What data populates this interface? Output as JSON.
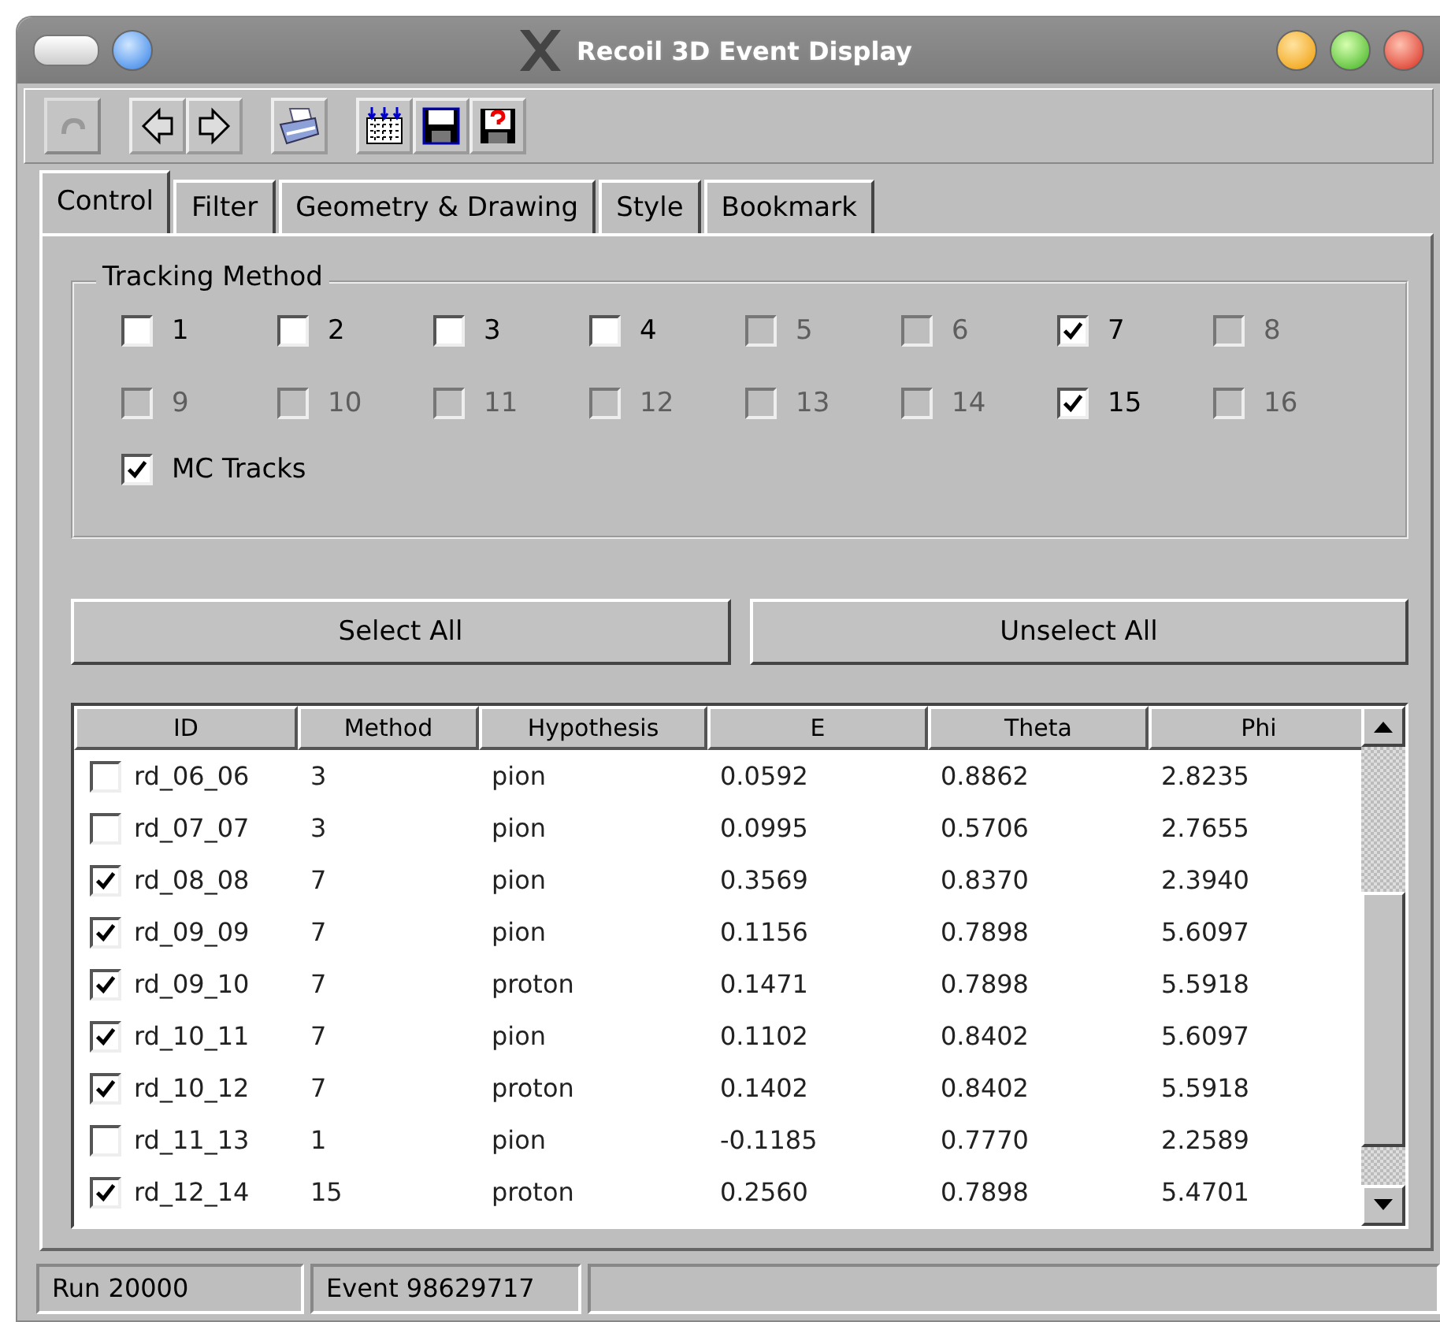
{
  "window": {
    "title": "Recoil 3D Event Display"
  },
  "toolbar": [
    {
      "kind": "back",
      "disabled": true
    },
    {
      "kind": "left",
      "disabled": false
    },
    {
      "kind": "right",
      "disabled": false
    },
    {
      "kind": "print",
      "disabled": false
    },
    {
      "kind": "load",
      "disabled": false
    },
    {
      "kind": "save",
      "disabled": false
    },
    {
      "kind": "help",
      "disabled": false
    }
  ],
  "tabs": [
    {
      "label": "Control",
      "selected": true
    },
    {
      "label": "Filter",
      "selected": false
    },
    {
      "label": "Geometry & Drawing",
      "selected": false
    },
    {
      "label": "Style",
      "selected": false
    },
    {
      "label": "Bookmark",
      "selected": false
    }
  ],
  "tracking_method": {
    "title": "Tracking Method",
    "methods": [
      {
        "label": "1",
        "checked": false,
        "disabled": false
      },
      {
        "label": "2",
        "checked": false,
        "disabled": false
      },
      {
        "label": "3",
        "checked": false,
        "disabled": false
      },
      {
        "label": "4",
        "checked": false,
        "disabled": false
      },
      {
        "label": "5",
        "checked": false,
        "disabled": true
      },
      {
        "label": "6",
        "checked": false,
        "disabled": true
      },
      {
        "label": "7",
        "checked": true,
        "disabled": false
      },
      {
        "label": "8",
        "checked": false,
        "disabled": true
      },
      {
        "label": "9",
        "checked": false,
        "disabled": true
      },
      {
        "label": "10",
        "checked": false,
        "disabled": true
      },
      {
        "label": "11",
        "checked": false,
        "disabled": true
      },
      {
        "label": "12",
        "checked": false,
        "disabled": true
      },
      {
        "label": "13",
        "checked": false,
        "disabled": true
      },
      {
        "label": "14",
        "checked": false,
        "disabled": true
      },
      {
        "label": "15",
        "checked": true,
        "disabled": false
      },
      {
        "label": "16",
        "checked": false,
        "disabled": true
      }
    ],
    "mc_tracks": {
      "label": "MC Tracks",
      "checked": true
    }
  },
  "buttons": [
    "Select All",
    "Unselect All"
  ],
  "table": {
    "columns": [
      "ID",
      "Method",
      "Hypothesis",
      "E",
      "Theta",
      "Phi"
    ],
    "rows": [
      {
        "checked": false,
        "cells": [
          "rd_06_06",
          "3",
          "pion",
          "0.0592",
          "0.8862",
          "2.8235"
        ]
      },
      {
        "checked": false,
        "cells": [
          "rd_07_07",
          "3",
          "pion",
          "0.0995",
          "0.5706",
          "2.7655"
        ]
      },
      {
        "checked": true,
        "cells": [
          "rd_08_08",
          "7",
          "pion",
          "0.3569",
          "0.8370",
          "2.3940"
        ]
      },
      {
        "checked": true,
        "cells": [
          "rd_09_09",
          "7",
          "pion",
          "0.1156",
          "0.7898",
          "5.6097"
        ]
      },
      {
        "checked": true,
        "cells": [
          "rd_09_10",
          "7",
          "proton",
          "0.1471",
          "0.7898",
          "5.5918"
        ]
      },
      {
        "checked": true,
        "cells": [
          "rd_10_11",
          "7",
          "pion",
          "0.1102",
          "0.8402",
          "5.6097"
        ]
      },
      {
        "checked": true,
        "cells": [
          "rd_10_12",
          "7",
          "proton",
          "0.1402",
          "0.8402",
          "5.5918"
        ]
      },
      {
        "checked": false,
        "cells": [
          "rd_11_13",
          "1",
          "pion",
          "-0.1185",
          "0.7770",
          "2.2589"
        ]
      },
      {
        "checked": true,
        "cells": [
          "rd_12_14",
          "15",
          "proton",
          "0.2560",
          "0.7898",
          "5.4701"
        ]
      }
    ]
  },
  "status_bar": [
    "Run 20000",
    "Event 98629717"
  ]
}
